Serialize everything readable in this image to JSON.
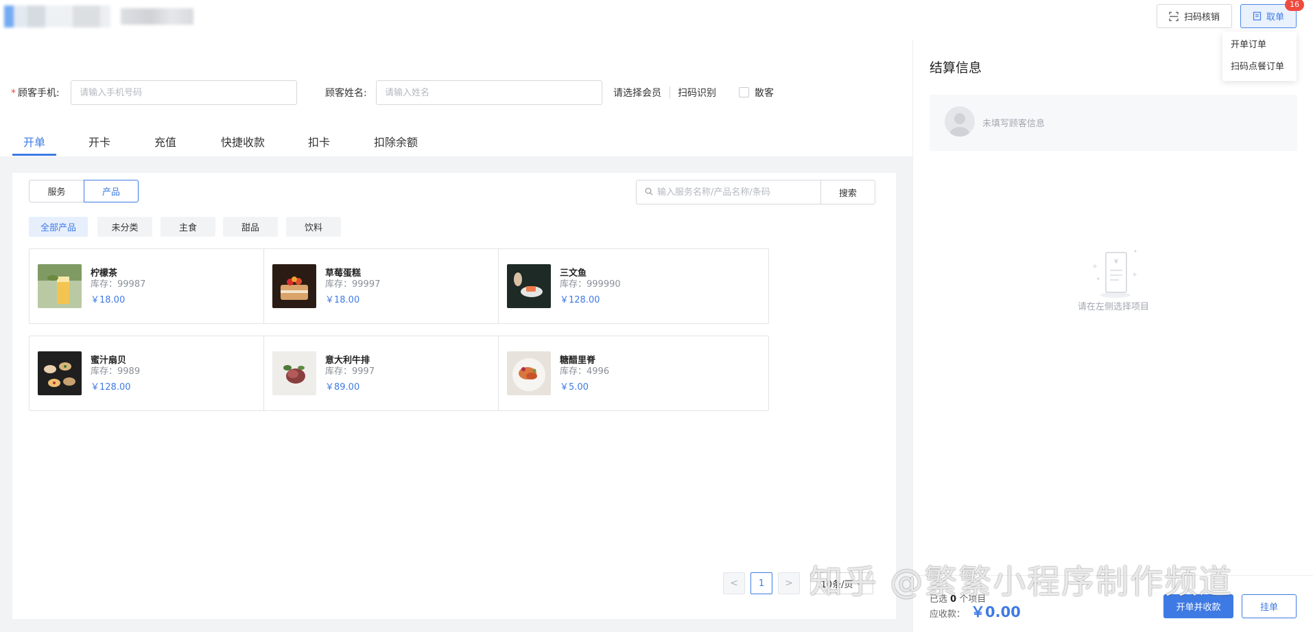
{
  "header": {
    "scan_verify_label": "扫码核销",
    "take_order_label": "取单",
    "take_order_badge": "16",
    "dropdown": [
      "开单订单",
      "扫码点餐订单"
    ]
  },
  "form": {
    "phone_label": "顾客手机:",
    "phone_placeholder": "请输入手机号码",
    "name_label": "顾客姓名:",
    "name_placeholder": "请输入姓名",
    "select_member": "请选择会员",
    "scan_identify": "扫码识别",
    "walk_in": "散客"
  },
  "tabs": [
    "开单",
    "开卡",
    "充值",
    "快捷收款",
    "扣卡",
    "扣除余额"
  ],
  "active_tab": "开单",
  "segment": [
    "服务",
    "产品"
  ],
  "search": {
    "placeholder": "输入服务名称/产品名称/条码",
    "button": "搜索"
  },
  "categories": [
    "全部产品",
    "未分类",
    "主食",
    "甜品",
    "饮料"
  ],
  "products": [
    {
      "name": "柠檬茶",
      "stock": "库存：99987",
      "price": "￥18.00"
    },
    {
      "name": "草莓蛋糕",
      "stock": "库存：99997",
      "price": "￥18.00"
    },
    {
      "name": "三文鱼",
      "stock": "库存：999990",
      "price": "￥128.00"
    },
    {
      "name": "蜜汁扇贝",
      "stock": "库存：9989",
      "price": "￥128.00"
    },
    {
      "name": "意大利牛排",
      "stock": "库存：9997",
      "price": "￥89.00"
    },
    {
      "name": "糖醋里脊",
      "stock": "库存：4996",
      "price": "￥5.00"
    }
  ],
  "pagination": {
    "prev": "<",
    "current": "1",
    "next": ">",
    "page_size": "10条/页"
  },
  "checkout": {
    "title": "结算信息",
    "no_customer": "未填写顾客信息",
    "empty_hint": "请在左侧选择项目",
    "selected_prefix": "已选",
    "selected_count": "0",
    "selected_suffix": "个项目",
    "due_label": "应收款：",
    "due_amount": "￥0.00",
    "primary_button": "开单并收款",
    "hold_button": "挂单"
  },
  "watermark": "知乎 @繁繁小程序制作频道",
  "colors": {
    "accent": "#3e7ae4",
    "badge": "#f04a3e"
  }
}
